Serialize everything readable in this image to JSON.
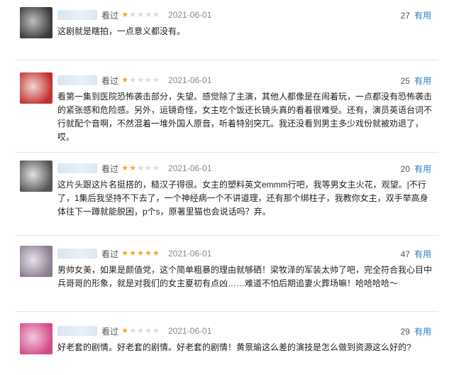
{
  "reviews": [
    {
      "watched_label": "看过",
      "rating": 1,
      "star_glyph": "★",
      "date": "2021-06-01",
      "votes": "27",
      "useful_label": "有用",
      "text": "这剧就是瞎拍，一点意义都没有。",
      "avatar_colors": [
        "#3a3a3a",
        "#bfbfbf"
      ]
    },
    {
      "watched_label": "看过",
      "rating": 1,
      "star_glyph": "★",
      "date": "2021-06-01",
      "votes": "25",
      "useful_label": "有用",
      "text": "看第一集到医院恐怖袭击部分，失望。感觉除了主演，其他人都像是在闹着玩，一点都没有恐怖袭击的紧张感和危险感。另外，运镜奇怪，女主吃个饭还长镜头真的看着很难受。还有，演员英语台词不行就配个音啊，不然混着一堆外国人原音，听着特别突兀。我还没看到男主多少戏份就被劝退了，哎。",
      "avatar_colors": [
        "#c0302e",
        "#f1d6d6"
      ]
    },
    {
      "watched_label": "看过",
      "rating": 2,
      "star_glyph": "★",
      "date": "2021-06-01",
      "votes": "20",
      "useful_label": "有用",
      "text": "这片头跟这片名挺搭的，糙汉子得很。女主的塑料英文emmm行吧，我等男女主火花，观望。|不行了，1集后我坚持不下去了，一个神经病一个不讲道理，还有那个绑柱子，我教你女主，双手举高身体往下一蹲就能脱困，p个s，原著里猫也会说话吗？弃。",
      "avatar_colors": [
        "#555555",
        "#e2e2e2"
      ]
    },
    {
      "watched_label": "看过",
      "rating": 5,
      "star_glyph": "★",
      "date": "2021-06-01",
      "votes": "47",
      "useful_label": "有用",
      "text": "男帅女美，如果是颜值党，这个简单粗暴的理由就够硒！梁牧泽的军装太帅了吧，完全符合我心目中兵哥哥的形象，就是对我们的女主夏初有点凶……难道不怕后期追妻火葬场嘛！哈哈哈哈～",
      "avatar_colors": [
        "#8a7d8f",
        "#e7e2ea"
      ]
    },
    {
      "watched_label": "看过",
      "rating": 1,
      "star_glyph": "★",
      "date": "2021-06-01",
      "votes": "29",
      "useful_label": "有用",
      "text": "好老套的剧情。好老套的剧情。好老套的剧情！黄景瑜这么差的演技是怎么做到资源这么好的?",
      "avatar_colors": [
        "#d24a8a",
        "#f4c9dd"
      ]
    }
  ]
}
